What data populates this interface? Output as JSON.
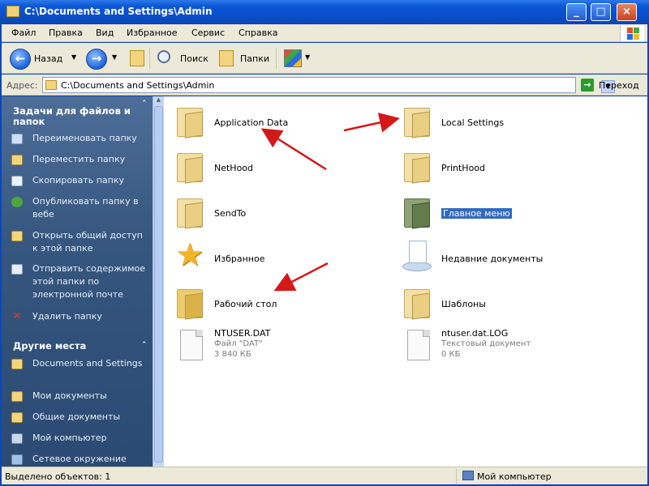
{
  "window": {
    "title": "C:\\Documents and Settings\\Admin",
    "buttons": {
      "minimize": "_",
      "maximize": "□",
      "close": "×"
    }
  },
  "menu": [
    "Файл",
    "Правка",
    "Вид",
    "Избранное",
    "Сервис",
    "Справка"
  ],
  "toolbar": {
    "back_label": "Назад",
    "search_label": "Поиск",
    "folders_label": "Папки"
  },
  "address": {
    "label": "Адрес:",
    "value": "C:\\Documents and Settings\\Admin",
    "go_label": "Переход"
  },
  "left_pane": {
    "tasks_title": "Задачи для файлов и папок",
    "tasks": [
      "Переименовать папку",
      "Переместить папку",
      "Скопировать папку",
      "Опубликовать папку в вебе",
      "Открыть общий доступ к этой папке",
      "Отправить содержимое этой папки по электронной почте",
      "Удалить папку"
    ],
    "places_title": "Другие места",
    "places": [
      "Documents and Settings",
      "Мои документы",
      "Общие документы",
      "Мой компьютер",
      "Сетевое окружение"
    ]
  },
  "items": [
    {
      "name": "Application Data",
      "icon": "folder-icon"
    },
    {
      "name": "Local Settings",
      "icon": "folder-icon"
    },
    {
      "name": "NetHood",
      "icon": "folder-icon"
    },
    {
      "name": "PrintHood",
      "icon": "folder-icon"
    },
    {
      "name": "SendTo",
      "icon": "folder-icon"
    },
    {
      "name": "Главное меню",
      "icon": "start-menu-folder-icon",
      "selected": true
    },
    {
      "name": "Избранное",
      "icon": "favorites-star-icon"
    },
    {
      "name": "Недавние документы",
      "icon": "recent-documents-icon"
    },
    {
      "name": "Рабочий стол",
      "icon": "desktop-folder-icon"
    },
    {
      "name": "Шаблоны",
      "icon": "folder-icon"
    },
    {
      "name": "NTUSER.DAT",
      "icon": "file-icon",
      "type": "Файл \"DAT\"",
      "size": "3 840 КБ"
    },
    {
      "name": "ntuser.dat.LOG",
      "icon": "file-icon",
      "type": "Текстовый документ",
      "size": "0 КБ"
    }
  ],
  "status": {
    "left": "Выделено объектов: 1",
    "right": "Мой компьютер"
  },
  "colors": {
    "titlebar": "#0b58d6",
    "leftpane": "#35567f",
    "selection": "#316ac5",
    "arrow": "#d41818"
  }
}
